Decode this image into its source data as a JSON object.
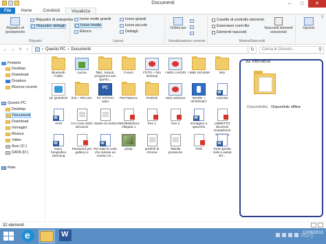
{
  "window": {
    "title": "Documenti",
    "controls": {
      "minimize": "–",
      "maximize": "□",
      "close": "✕"
    }
  },
  "ribbon_tabs": [
    "File",
    "Home",
    "Condividi",
    "Visualizza"
  ],
  "ribbon": {
    "riquadri": {
      "label": "Riquadri",
      "nav_pane": "Riquadro di spostamento",
      "preview": "Riquadro di anteprima",
      "details": "Riquadro dettagli"
    },
    "layout": {
      "label": "Layout",
      "options": [
        "Icone molto grandi",
        "Icone grandi",
        "Icone medie",
        "Icone piccole",
        "Elenco",
        "Dettagli"
      ],
      "selected": "Icone medie"
    },
    "current_view": {
      "label": "Visualizzazione corrente",
      "sort": "Ordina per"
    },
    "show_hide": {
      "label": "Mostra/Nascondi",
      "checkboxes": [
        "Caselle di controllo elementi",
        "Estensioni nomi file",
        "Elementi nascosti"
      ],
      "hide_selected": "Nascondi elementi selezionati",
      "options": "Opzioni"
    }
  },
  "address": {
    "path": [
      "Questo PC",
      "Documenti"
    ],
    "separator": "›",
    "search_placeholder": "Cerca in Docum..."
  },
  "nav_pane": {
    "items": [
      {
        "label": "Preferiti",
        "icon": "star-icon"
      },
      {
        "label": "Desktop",
        "icon": "folder-icon"
      },
      {
        "label": "Download",
        "icon": "folder-icon"
      },
      {
        "label": "Dropbox",
        "icon": "dropbox-icon"
      },
      {
        "label": "Risorse recenti",
        "icon": "folder-icon"
      },
      {
        "label": "Questo PC",
        "icon": "pc-icon"
      },
      {
        "label": "Desktop",
        "icon": "folder-icon"
      },
      {
        "label": "Documenti",
        "icon": "folder-icon"
      },
      {
        "label": "Download",
        "icon": "folder-icon"
      },
      {
        "label": "Immagini",
        "icon": "folder-icon"
      },
      {
        "label": "Musica",
        "icon": "folder-icon"
      },
      {
        "label": "Video",
        "icon": "folder-icon"
      },
      {
        "label": "Acer (C:)",
        "icon": "drive-icon"
      },
      {
        "label": "DATA (D:)",
        "icon": "drive-icon"
      },
      {
        "label": "Rete",
        "icon": "network-icon"
      }
    ]
  },
  "files": [
    {
      "name": "Bluetooth Folder",
      "type": "folder"
    },
    {
      "name": "cucina",
      "type": "house"
    },
    {
      "name": "filati , tessuti, programmi vari (punto...",
      "type": "folder"
    },
    {
      "name": "Forum",
      "type": "folder"
    },
    {
      "name": "FOTO + foto desktop",
      "type": "app"
    },
    {
      "name": "I MIEI LAVORI",
      "type": "app"
    },
    {
      "name": "I MIEI SCHEMI",
      "type": "folder"
    },
    {
      "name": "IMU",
      "type": "folder"
    },
    {
      "name": "LE QUERCE",
      "type": "shortcut"
    },
    {
      "name": "link + PICASA",
      "type": "folder"
    },
    {
      "name": "PC STITCH varie",
      "type": "pcicon"
    },
    {
      "name": "PM Patterns",
      "type": "folder"
    },
    {
      "name": "Preferiti",
      "type": "folder"
    },
    {
      "name": "varie antivirus",
      "type": "app"
    },
    {
      "name": "WORD + INTERNET",
      "type": "blue"
    },
    {
      "name": "Amicizia",
      "type": "word"
    },
    {
      "name": "AVIS",
      "type": "word"
    },
    {
      "name": "CH cross stitch istruzioni",
      "type": "doc"
    },
    {
      "name": "classe di merito",
      "type": "doc"
    },
    {
      "name": "DM10febb2014-Allegato 1",
      "type": "pdf"
    },
    {
      "name": "free 1",
      "type": "pdf"
    },
    {
      "name": "free 2",
      "type": "pdf"
    },
    {
      "name": "immagine a specchio",
      "type": "word"
    },
    {
      "name": "LIBRETTO istruzioni smartphone Samsung",
      "type": "pdf"
    },
    {
      "name": "macc. fotografica samsung",
      "type": "word"
    },
    {
      "name": "Password per gallery.ru",
      "type": "pdf"
    },
    {
      "name": "Per tutte le volte che indossi un sorriso ch...",
      "type": "word"
    },
    {
      "name": "pizap",
      "type": "img"
    },
    {
      "name": "preferiti di chrome",
      "type": "doc"
    },
    {
      "name": "Tabella pressione",
      "type": "doc"
    },
    {
      "name": "TARI",
      "type": "pdf"
    },
    {
      "name": "Torta spirale mele e pasta sfo...",
      "type": "word"
    }
  ],
  "details_pane": {
    "count": "32 elementi",
    "availability_label": "Disponibilità:",
    "availability_value": "Disponibile offline"
  },
  "status_bar": {
    "count": "32 elementi"
  },
  "taskbar": {
    "date": "12/06/2013",
    "watermark": "Mary"
  },
  "colors": {
    "accent": "#1979ca",
    "selection": "#cce8ff",
    "taskbar": "#5a8fc6",
    "annotation": "#2a3f8f"
  }
}
